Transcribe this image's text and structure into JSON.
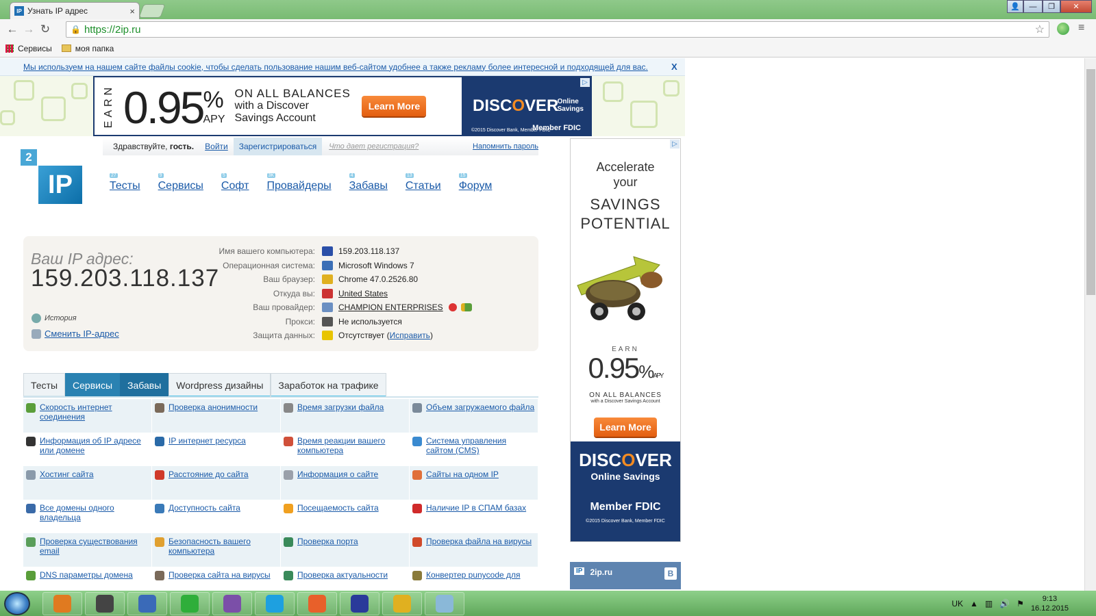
{
  "browser": {
    "tab_title": "Узнать IP адрес",
    "tab_favicon": "IP",
    "close_tab": "×",
    "url": "https://2ip.ru",
    "window_buttons": {
      "user": "👤",
      "minimize": "—",
      "maximize": "❐",
      "close": "✕"
    },
    "bookmarks": [
      {
        "label": "Сервисы",
        "icon": "apps-grid-icon"
      },
      {
        "label": "моя папка",
        "icon": "folder-icon"
      }
    ]
  },
  "cookie_notice": {
    "text": "Мы используем на нашем сайте файлы cookie, чтобы сделать пользование нашим веб-сайтом удобнее а также рекламу более интересной и подходящей для вас.",
    "close": "X"
  },
  "top_ad": {
    "earn": "EARN",
    "rate": "0.95",
    "percent": "%",
    "apy": "APY",
    "line1": "ON ALL BALANCES",
    "line2": "with a Discover",
    "line3": "Savings Account",
    "button": "Learn More",
    "brand_a": "DISC",
    "brand_o": "O",
    "brand_b": "VER",
    "brand_sub1": "Online",
    "brand_sub2": "Savings",
    "fdic": "Member FDIC",
    "copyright": "©2015 Discover Bank, Member FDIC"
  },
  "login_bar": {
    "greeting": "Здравствуйте, ",
    "guest": "гость.",
    "login": "Войти",
    "register": "Зарегистрироваться",
    "what_gives": "Что дает регистрация?",
    "remind": "Напомнить пароль"
  },
  "logo": {
    "two": "2",
    "ip": "IP"
  },
  "main_menu": [
    {
      "label": "Тесты",
      "count": "27"
    },
    {
      "label": "Сервисы",
      "count": "9"
    },
    {
      "label": "Софт",
      "count": "5"
    },
    {
      "label": "Провайдеры",
      "count": "3K"
    },
    {
      "label": "Забавы",
      "count": "4"
    },
    {
      "label": "Статьи",
      "count": "13"
    },
    {
      "label": "Форум",
      "count": "15"
    }
  ],
  "ip_info": {
    "label": "Ваш IP адрес:",
    "ip": "159.203.118.137",
    "history": "История",
    "change_ip": "Сменить IP-адрес",
    "details": [
      {
        "key": "Имя вашего компьютера:",
        "value": "159.203.118.137",
        "link": false,
        "color": "#2a4fa8"
      },
      {
        "key": "Операционная система:",
        "value": "Microsoft Windows 7",
        "link": false,
        "color": "#3b6fb6"
      },
      {
        "key": "Ваш браузер:",
        "value": "Chrome 47.0.2526.80",
        "link": false,
        "color": "#e0b020"
      },
      {
        "key": "Откуда вы:",
        "value": "United States",
        "link": true,
        "color": "#c33"
      },
      {
        "key": "Ваш провайдер:",
        "value": "CHAMPION ENTERPRISES",
        "link": true,
        "color": "#6b8fc2"
      },
      {
        "key": "Прокси:",
        "value": "Не используется",
        "link": false,
        "color": "#555"
      },
      {
        "key": "Защита данных:",
        "value": "Отсутствует (",
        "link": false,
        "color": "#e8c400",
        "fix": "Исправить",
        "tail": ")"
      }
    ]
  },
  "service_tabs": [
    "Тесты",
    "Сервисы",
    "Забавы",
    "Wordpress дизайны",
    "Заработок на трафике"
  ],
  "services": [
    {
      "label": "Скорость интернет соединения",
      "color": "#5a9e3a"
    },
    {
      "label": "Проверка анонимности",
      "color": "#7a6a5a"
    },
    {
      "label": "Время загрузки файла",
      "color": "#888"
    },
    {
      "label": "Объем загружаемого файла",
      "color": "#7a8a9a"
    },
    {
      "label": "Информация об IP адресе или домене",
      "color": "#333"
    },
    {
      "label": "IP интернет ресурса",
      "color": "#2a6aa8"
    },
    {
      "label": "Время реакции вашего компьютера",
      "color": "#d0503a"
    },
    {
      "label": "Система управления сайтом (CMS)",
      "color": "#3a8ad0"
    },
    {
      "label": "Хостинг сайта",
      "color": "#8a9aaa"
    },
    {
      "label": "Расстояние до сайта",
      "color": "#d03a2a"
    },
    {
      "label": "Информация о сайте",
      "color": "#9aa0aa"
    },
    {
      "label": "Сайты на одном IP",
      "color": "#e0703a"
    },
    {
      "label": "Все домены одного владельца",
      "color": "#3a6aa8"
    },
    {
      "label": "Доступность сайта",
      "color": "#3a7ab8"
    },
    {
      "label": "Посещаемость сайта",
      "color": "#f0a020"
    },
    {
      "label": "Наличие IP в СПАМ базах",
      "color": "#d02a2a"
    },
    {
      "label": "Проверка существования email",
      "color": "#5a9e5a"
    },
    {
      "label": "Безопасность вашего компьютера",
      "color": "#e0a030"
    },
    {
      "label": "Проверка порта",
      "color": "#3a8a5a"
    },
    {
      "label": "Проверка файла на вирусы",
      "color": "#d04a2a"
    },
    {
      "label": "DNS параметры домена",
      "color": "#5a9e3a"
    },
    {
      "label": "Проверка сайта на вирусы",
      "color": "#7a6a5a"
    },
    {
      "label": "Проверка актуальности",
      "color": "#3a8a5a"
    },
    {
      "label": "Конвертер punycode для",
      "color": "#8a7a3a"
    }
  ],
  "side_ad": {
    "accelerate": "Accelerate",
    "your": "your",
    "savings": "SAVINGS",
    "potential": "POTENTIAL",
    "earn": "EARN",
    "rate": "0.95",
    "percent": "%",
    "apy": "APY",
    "on_all": "ON ALL BALANCES",
    "with": "with a Discover Savings Account",
    "button": "Learn More",
    "brand_a": "DISC",
    "brand_o": "O",
    "brand_b": "VER",
    "online": "Online Savings",
    "fdic": "Member FDIC",
    "copyright": "©2015 Discover Bank, Member FDIC"
  },
  "vk_widget": {
    "site": "2ip.ru",
    "logo": "B"
  },
  "taskbar": {
    "apps": [
      {
        "name": "media-player-icon",
        "color": "#e07a20"
      },
      {
        "name": "media-player-classic-icon",
        "color": "#444"
      },
      {
        "name": "pen-editor-icon",
        "color": "#3a6ab8"
      },
      {
        "name": "whatsapp-icon",
        "color": "#2fae3a"
      },
      {
        "name": "viber-icon",
        "color": "#7b4fa8"
      },
      {
        "name": "skype-icon",
        "color": "#1ea0e0"
      },
      {
        "name": "firefox-icon",
        "color": "#e8602a"
      },
      {
        "name": "save-disk-icon",
        "color": "#2a3a9a"
      },
      {
        "name": "chrome-icon",
        "color": "#e0b020"
      },
      {
        "name": "notes-icon",
        "color": "#8ab8d8"
      }
    ],
    "lang": "UK",
    "time": "9:13",
    "date": "16.12.2015"
  }
}
